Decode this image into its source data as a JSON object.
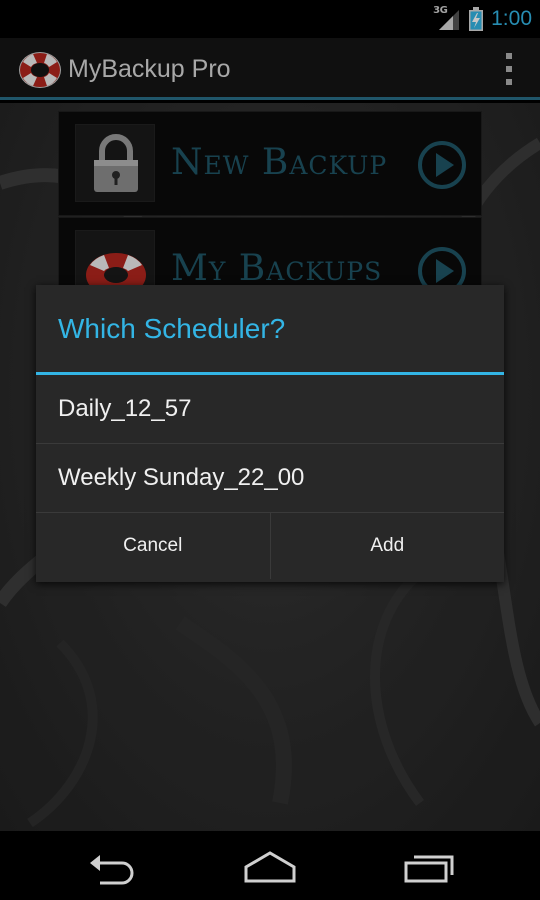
{
  "status_bar": {
    "network_label": "3G",
    "time": "1:00",
    "icons": [
      "signal-icon",
      "battery-charging-icon"
    ]
  },
  "action_bar": {
    "title": "MyBackup Pro",
    "icons": [
      "app-lifebuoy-icon",
      "overflow-menu-icon"
    ]
  },
  "menu": {
    "items": [
      {
        "label": "New Backup",
        "icon": "lock-icon"
      },
      {
        "label": "My Backups",
        "icon": "lifebuoy-icon"
      }
    ]
  },
  "dialog": {
    "title": "Which Scheduler?",
    "items": [
      {
        "label": "Daily_12_57"
      },
      {
        "label": "Weekly Sunday_22_00"
      }
    ],
    "cancel_label": "Cancel",
    "add_label": "Add"
  },
  "nav_bar": {
    "icons": [
      "back-icon",
      "home-icon",
      "recent-apps-icon"
    ]
  },
  "colors": {
    "accent": "#33b5e5",
    "tile_text": "#1f5566",
    "dialog_bg": "#282828"
  }
}
